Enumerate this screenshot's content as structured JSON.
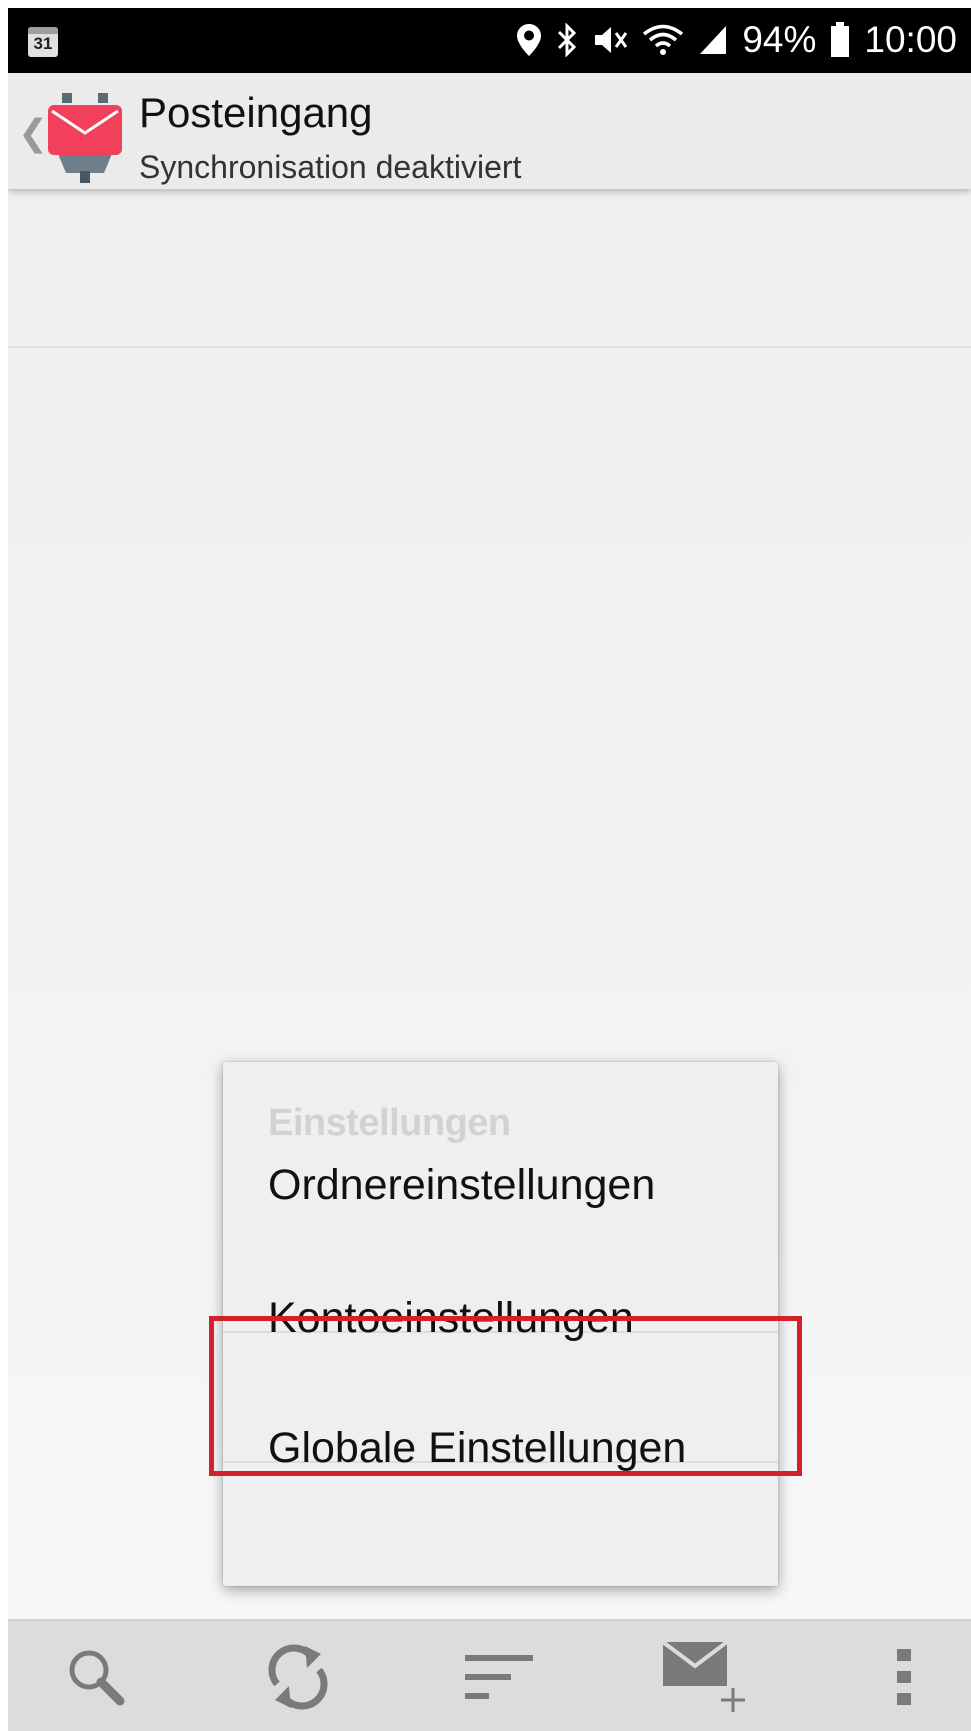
{
  "status_bar": {
    "calendar_day": "31",
    "battery_text": "94%",
    "time": "10:00",
    "icons": [
      "location-icon",
      "bluetooth-icon",
      "mute-icon",
      "wifi-icon",
      "signal-icon",
      "battery-icon"
    ]
  },
  "action_bar": {
    "title": "Posteingang",
    "subtitle": "Synchronisation deaktiviert",
    "logo_color": "#f0405a"
  },
  "menu": {
    "header": "Einstellungen",
    "items": [
      {
        "label": "Ordnereinstellungen"
      },
      {
        "label": "Kontoeinstellungen",
        "highlighted": true
      },
      {
        "label": "Globale Einstellungen"
      }
    ],
    "highlight_color": "#d3202a"
  },
  "bottom_bar": {
    "buttons": [
      "search-icon",
      "refresh-icon",
      "sort-icon",
      "compose-icon",
      "overflow-menu-icon"
    ]
  }
}
